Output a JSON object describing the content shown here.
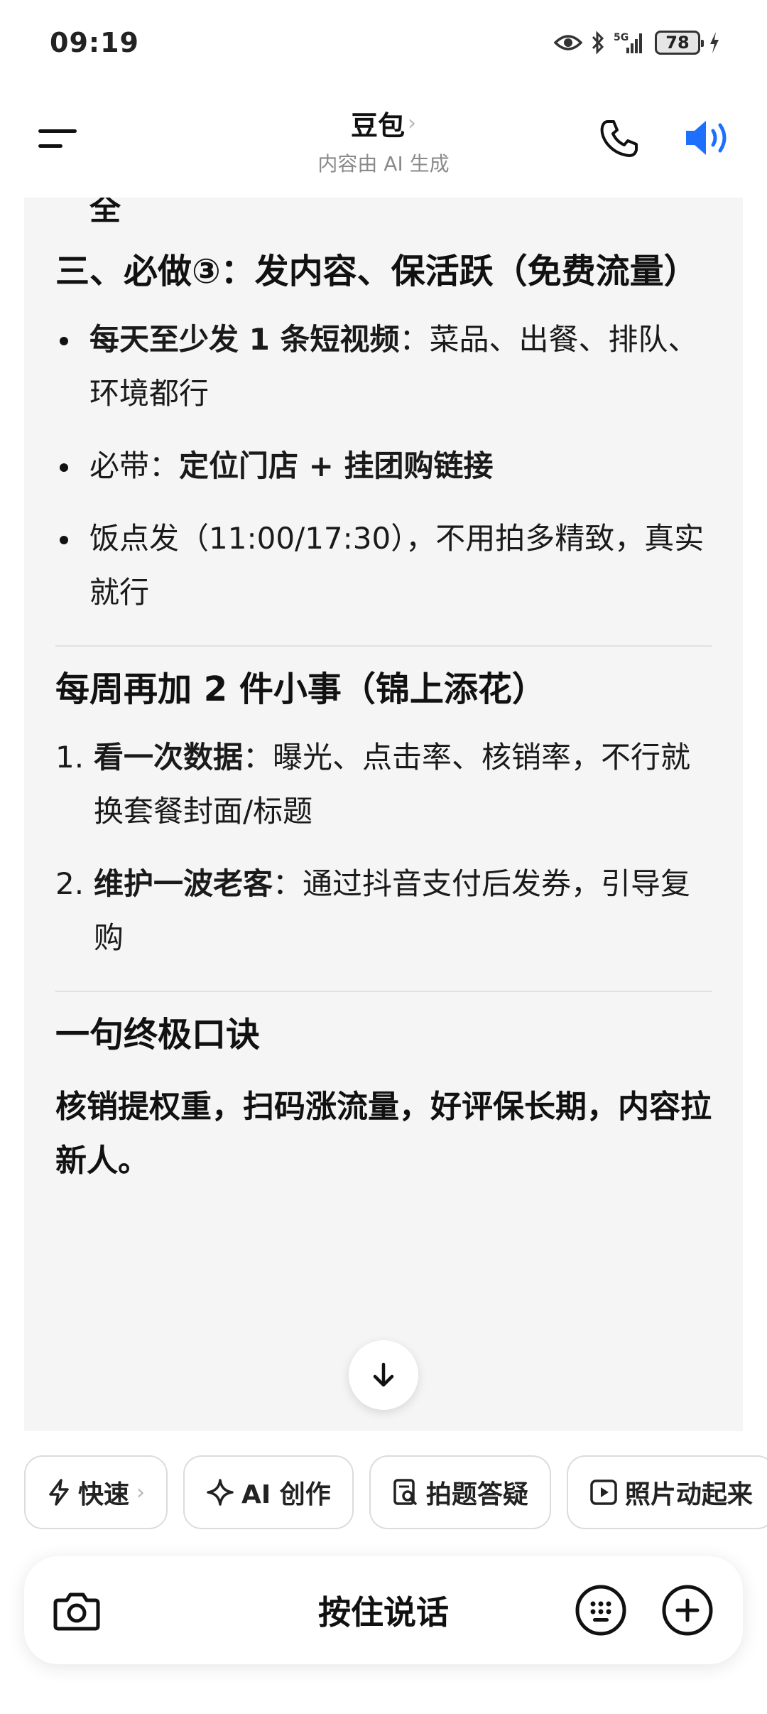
{
  "status_bar": {
    "time": "09:19",
    "network": "5G",
    "battery": "78",
    "icons": [
      "eye-icon",
      "bluetooth-icon",
      "signal-icon",
      "battery-icon",
      "charging-icon"
    ]
  },
  "header": {
    "title": "豆包",
    "title_chevron": "›",
    "subtitle": "内容由 AI 生成"
  },
  "content": {
    "partial_top": "全",
    "section3": {
      "heading": "三、必做③：发内容、保活跃（免费流量）",
      "bullets": [
        {
          "bold": "每天至少发 1 条短视频",
          "rest": "：菜品、出餐、排队、环境都行"
        },
        {
          "prefix": "必带：",
          "bold": "定位门店 + 挂团购链接"
        },
        {
          "rest": "饭点发（11:00/17:30），不用拍多精致，真实就行"
        }
      ]
    },
    "weekly": {
      "heading": "每周再加 2 件小事（锦上添花）",
      "items": [
        {
          "num": "1.",
          "bold": "看一次数据",
          "rest": "：曝光、点击率、核销率，不行就换套餐封面/标题"
        },
        {
          "num": "2.",
          "bold": "维护一波老客",
          "rest": "：通过抖音支付后发券，引导复购"
        }
      ]
    },
    "motto": {
      "heading": "一句终极口诀",
      "text": "核销提权重，扫码涨流量，好评保长期，内容拉新人。"
    }
  },
  "chips": [
    {
      "label": "快速",
      "icon": "lightning-icon",
      "chevron": "›"
    },
    {
      "label": "AI 创作",
      "icon": "sparkle-icon"
    },
    {
      "label": "拍题答疑",
      "icon": "photo-question-icon"
    },
    {
      "label": "照片动起来",
      "icon": "play-icon"
    }
  ],
  "input_bar": {
    "hold_to_talk": "按住说话"
  },
  "colors": {
    "accent_blue": "#1f6fff",
    "card_bg": "#f5f5f5"
  }
}
